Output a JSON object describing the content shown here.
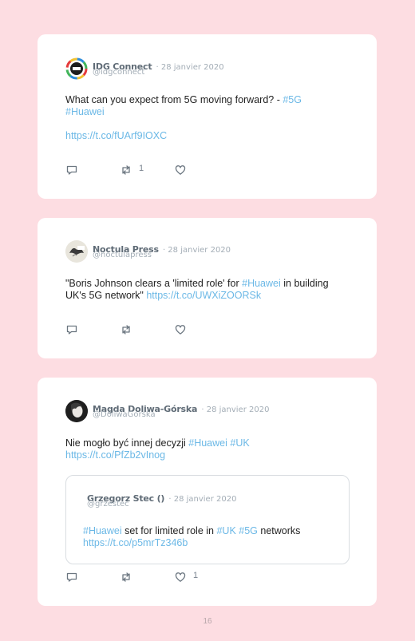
{
  "tweets": [
    {
      "author": "IDG Connect",
      "date": "· 28 janvier 2020",
      "handle": "@idgconnect",
      "text_main": "What can you expect from 5G moving forward? -",
      "tag1": "#5G",
      "tag2": "#Huawei",
      "link": "https://t.co/fUArf9IOXC",
      "retweets": "1",
      "likes": ""
    },
    {
      "author": "Noctula Press",
      "date": "· 28 janvier 2020",
      "handle": "@noctulapress",
      "text_a": "\"Boris Johnson clears a 'limited role' for",
      "tag1": "#Huawei",
      "text_b": "in building",
      "text_c": "UK's 5G network\"",
      "link": "https://t.co/UWXiZOORSk"
    },
    {
      "author": "Magda Doliwa-Górska",
      "date": "· 28 janvier 2020",
      "handle": "@DoliwaGorska",
      "text_main": "Nie mogło być innej decyzji",
      "tag1": "#Huawei",
      "tag2": "#UK",
      "link": "https://t.co/PfZb2vInog",
      "likes": "1",
      "quote": {
        "author": "Grzegorz Stec ()",
        "date": "· 28 janvier 2020",
        "handle": "@grzestec",
        "tag1": "#Huawei",
        "text_a": "set for limited role in",
        "tag2": "#UK",
        "tag3": "#5G",
        "text_b": "networks",
        "link": "https://t.co/p5mrTz346b"
      }
    }
  ],
  "icons": [
    "reply-icon",
    "retweet-icon",
    "like-icon"
  ],
  "colors": {
    "background": "#fddde2",
    "hashtag": "#6bb8e6",
    "card": "#ffffff"
  },
  "page_number": "16"
}
